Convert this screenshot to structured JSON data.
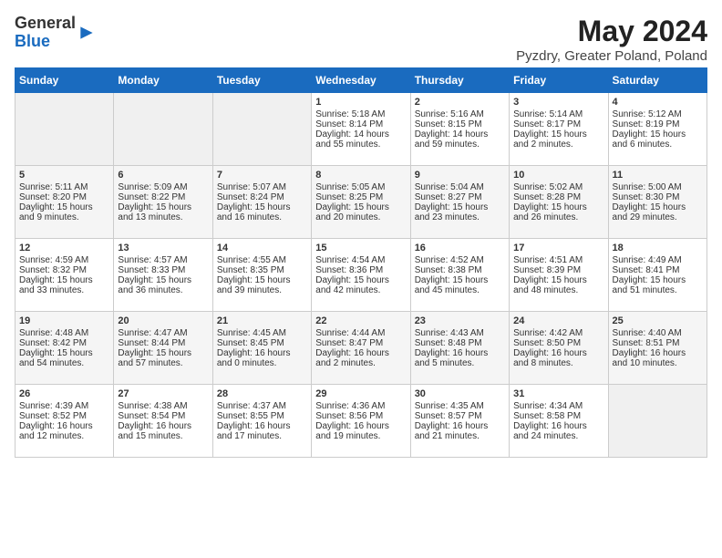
{
  "logo": {
    "general": "General",
    "blue": "Blue"
  },
  "title": "May 2024",
  "subtitle": "Pyzdry, Greater Poland, Poland",
  "days_header": [
    "Sunday",
    "Monday",
    "Tuesday",
    "Wednesday",
    "Thursday",
    "Friday",
    "Saturday"
  ],
  "weeks": [
    [
      {
        "day": "",
        "content": ""
      },
      {
        "day": "",
        "content": ""
      },
      {
        "day": "",
        "content": ""
      },
      {
        "day": "1",
        "content": "Sunrise: 5:18 AM\nSunset: 8:14 PM\nDaylight: 14 hours\nand 55 minutes."
      },
      {
        "day": "2",
        "content": "Sunrise: 5:16 AM\nSunset: 8:15 PM\nDaylight: 14 hours\nand 59 minutes."
      },
      {
        "day": "3",
        "content": "Sunrise: 5:14 AM\nSunset: 8:17 PM\nDaylight: 15 hours\nand 2 minutes."
      },
      {
        "day": "4",
        "content": "Sunrise: 5:12 AM\nSunset: 8:19 PM\nDaylight: 15 hours\nand 6 minutes."
      }
    ],
    [
      {
        "day": "5",
        "content": "Sunrise: 5:11 AM\nSunset: 8:20 PM\nDaylight: 15 hours\nand 9 minutes."
      },
      {
        "day": "6",
        "content": "Sunrise: 5:09 AM\nSunset: 8:22 PM\nDaylight: 15 hours\nand 13 minutes."
      },
      {
        "day": "7",
        "content": "Sunrise: 5:07 AM\nSunset: 8:24 PM\nDaylight: 15 hours\nand 16 minutes."
      },
      {
        "day": "8",
        "content": "Sunrise: 5:05 AM\nSunset: 8:25 PM\nDaylight: 15 hours\nand 20 minutes."
      },
      {
        "day": "9",
        "content": "Sunrise: 5:04 AM\nSunset: 8:27 PM\nDaylight: 15 hours\nand 23 minutes."
      },
      {
        "day": "10",
        "content": "Sunrise: 5:02 AM\nSunset: 8:28 PM\nDaylight: 15 hours\nand 26 minutes."
      },
      {
        "day": "11",
        "content": "Sunrise: 5:00 AM\nSunset: 8:30 PM\nDaylight: 15 hours\nand 29 minutes."
      }
    ],
    [
      {
        "day": "12",
        "content": "Sunrise: 4:59 AM\nSunset: 8:32 PM\nDaylight: 15 hours\nand 33 minutes."
      },
      {
        "day": "13",
        "content": "Sunrise: 4:57 AM\nSunset: 8:33 PM\nDaylight: 15 hours\nand 36 minutes."
      },
      {
        "day": "14",
        "content": "Sunrise: 4:55 AM\nSunset: 8:35 PM\nDaylight: 15 hours\nand 39 minutes."
      },
      {
        "day": "15",
        "content": "Sunrise: 4:54 AM\nSunset: 8:36 PM\nDaylight: 15 hours\nand 42 minutes."
      },
      {
        "day": "16",
        "content": "Sunrise: 4:52 AM\nSunset: 8:38 PM\nDaylight: 15 hours\nand 45 minutes."
      },
      {
        "day": "17",
        "content": "Sunrise: 4:51 AM\nSunset: 8:39 PM\nDaylight: 15 hours\nand 48 minutes."
      },
      {
        "day": "18",
        "content": "Sunrise: 4:49 AM\nSunset: 8:41 PM\nDaylight: 15 hours\nand 51 minutes."
      }
    ],
    [
      {
        "day": "19",
        "content": "Sunrise: 4:48 AM\nSunset: 8:42 PM\nDaylight: 15 hours\nand 54 minutes."
      },
      {
        "day": "20",
        "content": "Sunrise: 4:47 AM\nSunset: 8:44 PM\nDaylight: 15 hours\nand 57 minutes."
      },
      {
        "day": "21",
        "content": "Sunrise: 4:45 AM\nSunset: 8:45 PM\nDaylight: 16 hours\nand 0 minutes."
      },
      {
        "day": "22",
        "content": "Sunrise: 4:44 AM\nSunset: 8:47 PM\nDaylight: 16 hours\nand 2 minutes."
      },
      {
        "day": "23",
        "content": "Sunrise: 4:43 AM\nSunset: 8:48 PM\nDaylight: 16 hours\nand 5 minutes."
      },
      {
        "day": "24",
        "content": "Sunrise: 4:42 AM\nSunset: 8:50 PM\nDaylight: 16 hours\nand 8 minutes."
      },
      {
        "day": "25",
        "content": "Sunrise: 4:40 AM\nSunset: 8:51 PM\nDaylight: 16 hours\nand 10 minutes."
      }
    ],
    [
      {
        "day": "26",
        "content": "Sunrise: 4:39 AM\nSunset: 8:52 PM\nDaylight: 16 hours\nand 12 minutes."
      },
      {
        "day": "27",
        "content": "Sunrise: 4:38 AM\nSunset: 8:54 PM\nDaylight: 16 hours\nand 15 minutes."
      },
      {
        "day": "28",
        "content": "Sunrise: 4:37 AM\nSunset: 8:55 PM\nDaylight: 16 hours\nand 17 minutes."
      },
      {
        "day": "29",
        "content": "Sunrise: 4:36 AM\nSunset: 8:56 PM\nDaylight: 16 hours\nand 19 minutes."
      },
      {
        "day": "30",
        "content": "Sunrise: 4:35 AM\nSunset: 8:57 PM\nDaylight: 16 hours\nand 21 minutes."
      },
      {
        "day": "31",
        "content": "Sunrise: 4:34 AM\nSunset: 8:58 PM\nDaylight: 16 hours\nand 24 minutes."
      },
      {
        "day": "",
        "content": ""
      }
    ]
  ]
}
